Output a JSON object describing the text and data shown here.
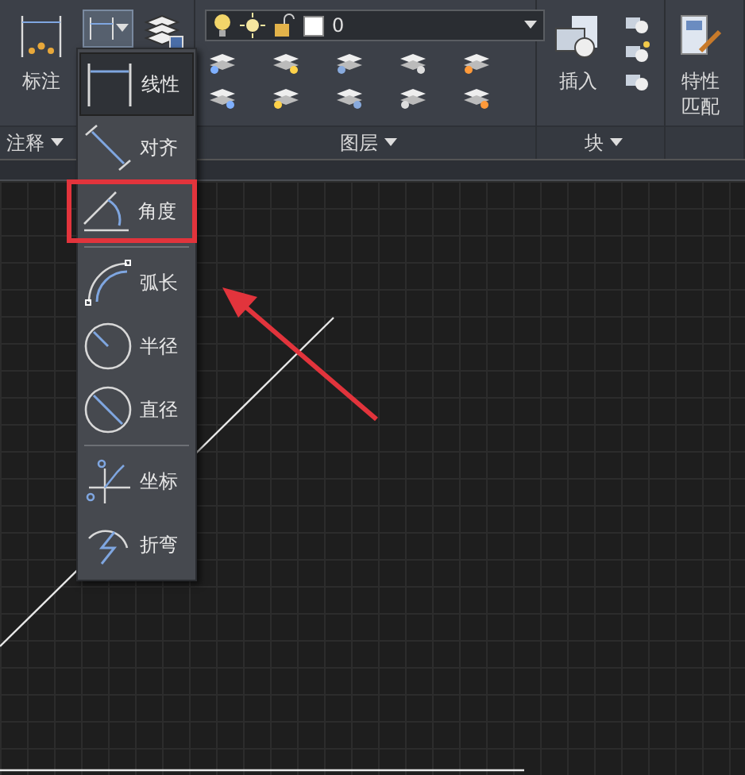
{
  "ribbon": {
    "panels": [
      {
        "kind": "annotation",
        "title": "注释",
        "tool": {
          "label": "标注"
        },
        "dim_button": {
          "expanded": true
        }
      },
      {
        "kind": "layers",
        "title": "图层",
        "layer": {
          "value": "0"
        }
      },
      {
        "kind": "block",
        "title": "块",
        "tool": {
          "label": "插入"
        }
      },
      {
        "kind": "properties",
        "tool": {
          "label": "特性匹配"
        }
      }
    ]
  },
  "dim_menu": {
    "groups": [
      [
        {
          "label": "线性",
          "kind": "linear",
          "current": true,
          "highlighted": false
        },
        {
          "label": "对齐",
          "kind": "aligned",
          "current": false,
          "highlighted": false
        },
        {
          "label": "角度",
          "kind": "angular",
          "current": false,
          "highlighted": true
        }
      ],
      [
        {
          "label": "弧长",
          "kind": "arc",
          "current": false,
          "highlighted": false
        },
        {
          "label": "半径",
          "kind": "radius",
          "current": false,
          "highlighted": false
        },
        {
          "label": "直径",
          "kind": "diameter",
          "current": false,
          "highlighted": false
        }
      ],
      [
        {
          "label": "坐标",
          "kind": "ordinate",
          "current": false,
          "highlighted": false
        },
        {
          "label": "折弯",
          "kind": "jogged",
          "current": false,
          "highlighted": false
        }
      ]
    ]
  }
}
